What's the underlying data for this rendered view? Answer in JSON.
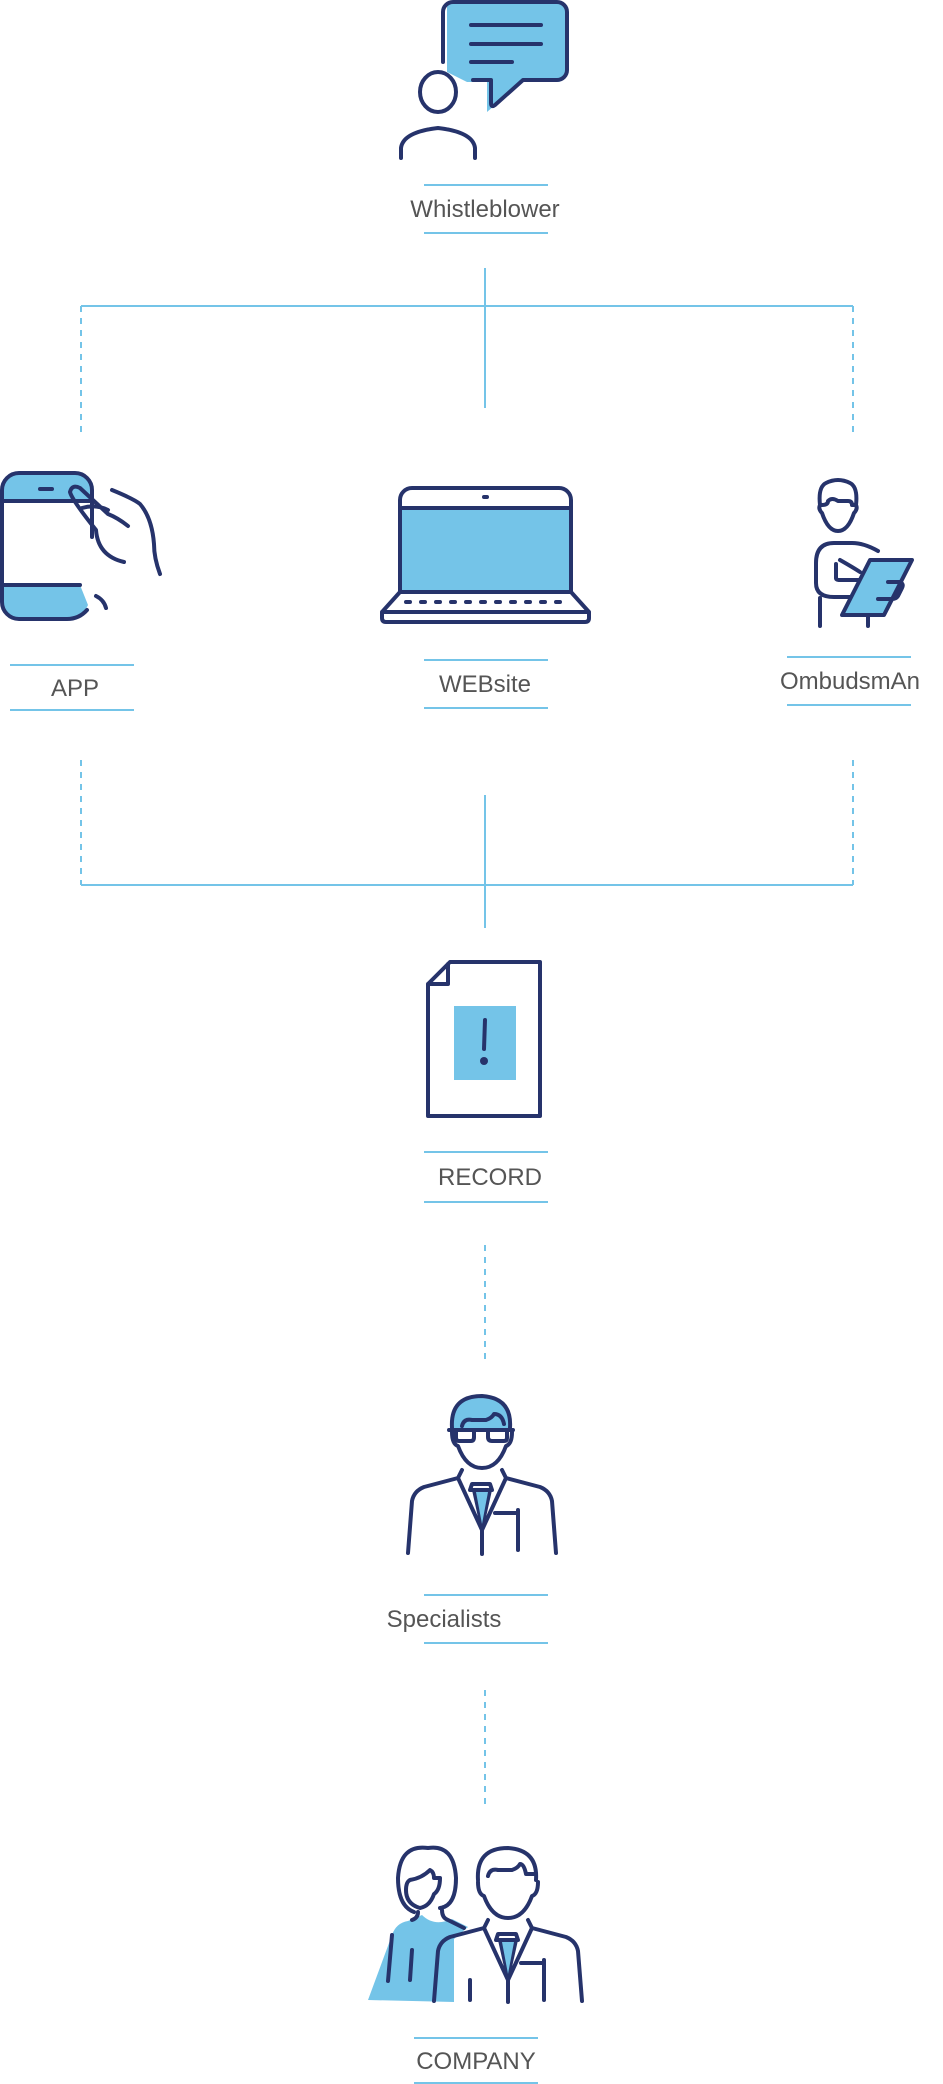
{
  "nodes": {
    "whistleblower": "Whistleblower",
    "app": "APP",
    "website": "WEBsite",
    "ombudsman": "OmbudsmAn",
    "record": "RECORD",
    "specialists": "Specialists",
    "company": "COMPANY"
  },
  "colors": {
    "primary": "#26336b",
    "accent": "#74c4e8",
    "text": "#555555"
  }
}
